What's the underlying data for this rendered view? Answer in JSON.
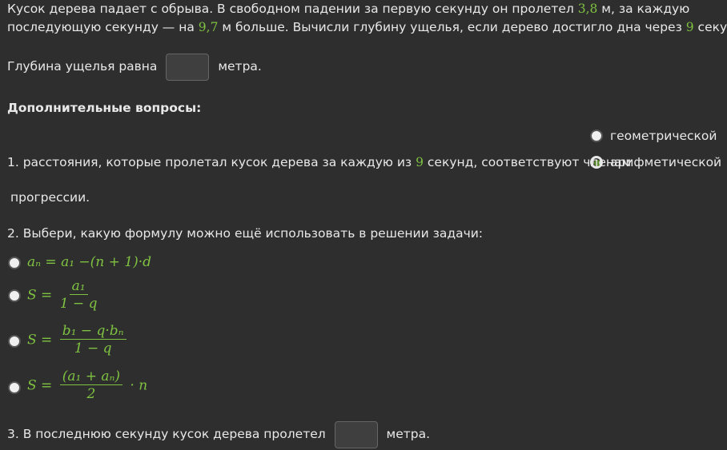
{
  "problem": {
    "p1": "Кусок дерева падает с обрыва. В свободном падении за первую секунду он пролетел ",
    "v1": "3,8",
    "p2": " м, за каждую",
    "p3": "последующую секунду — на ",
    "v2": "9,7",
    "p4": " м больше. Вычисли глубину ущелья, если дерево достигло дна через ",
    "v3": "9",
    "p5": " секунд."
  },
  "answer": {
    "before": "Глубина ущелья равна",
    "after": "метра."
  },
  "additional_title": "Дополнительные вопросы:",
  "q1": {
    "text_before": "1. расстояния, которые пролетал кусок дерева за каждую из ",
    "num": "9",
    "text_after": " секунд, соответствуют членам",
    "options": [
      "геометрической",
      "арифметической"
    ],
    "selected": 1,
    "tail": "прогрессии."
  },
  "q2": {
    "text": "2. Выбери, какую формулу можно ещё использовать в решении задачи:",
    "opt1": "aₙ = a₁ −(n + 1)·d",
    "opt2": {
      "lhs": "S =",
      "num": "a₁",
      "den": "1 − q"
    },
    "opt3": {
      "lhs": "S =",
      "num": "b₁ − q·bₙ",
      "den": "1 − q"
    },
    "opt4": {
      "lhs": "S =",
      "num": "(a₁ + aₙ)",
      "den": "2",
      "tail": "· n"
    }
  },
  "q3": {
    "before": "3. В последнюю секунду кусок дерева пролетел",
    "after": "метра."
  }
}
